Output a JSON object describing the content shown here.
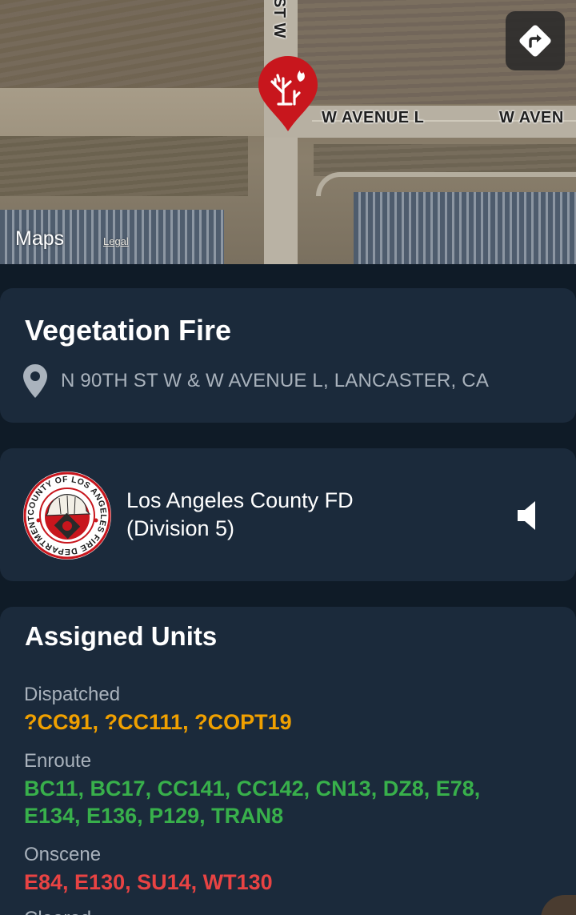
{
  "map": {
    "road_label_avenue_1": "W AVENUE L",
    "road_label_avenue_2": "W AVEN",
    "road_label_street": "ST W",
    "maps_logo": "Maps",
    "legal_link": "Legal"
  },
  "incident": {
    "title": "Vegetation Fire",
    "location": "N 90TH ST W & W AVENUE L, LANCASTER, CA"
  },
  "agency": {
    "name_line_1": "Los Angeles County FD",
    "name_line_2": "(Division 5)",
    "seal_text": "COUNTY OF LOS ANGELES FIRE DEPARTMENT"
  },
  "units": {
    "title": "Assigned Units",
    "dispatched_label": "Dispatched",
    "dispatched": "?CC91, ?CC111, ?COPT19",
    "enroute_label": "Enroute",
    "enroute_line_1": "BC11, BC17, CC141, CC142, CN13, DZ8, E78,",
    "enroute_line_2": "E134, E136, P129, TRAN8",
    "onscene_label": "Onscene",
    "onscene": "E84, E130, SU14, WT130",
    "cleared_label": "Cleared"
  },
  "colors": {
    "background": "#0f1b27",
    "card": "#1b2a3b",
    "dispatched": "#f0a000",
    "enroute": "#38b04b",
    "onscene": "#e84343",
    "pin": "#c8161d"
  },
  "icons": {
    "map_pin": "vegetation-fire-pin-icon",
    "directions": "directions-icon",
    "location": "location-pin-icon",
    "audio": "speaker-icon"
  }
}
